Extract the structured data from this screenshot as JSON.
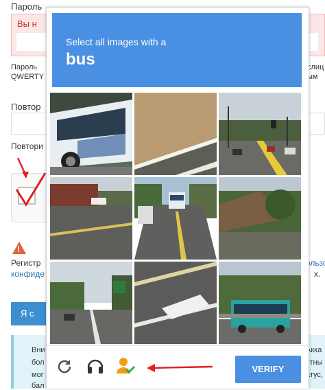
{
  "background_form": {
    "password_label": "Пароль",
    "error_text": "Вы н",
    "password_hint": "Пароль",
    "password_hint_line2": "QWERTY",
    "right_hint_1": "слиц",
    "right_hint_2": "ым",
    "repeat_label_1": "Повтор",
    "repeat_label_2": "Повтори",
    "register_text": "Регистр",
    "register_link_left": "конфиде",
    "register_link_right": "ользо",
    "register_right_2": "х.",
    "submit_button_label": "Я с",
    "info_lines": [
      "Вни",
      "бол",
      "мог",
      "бал"
    ],
    "info_right": [
      "Акка",
      "стны",
      "атус,"
    ],
    "info_bottom": "бал... ... ...ые"
  },
  "challenge": {
    "prompt_text": "Select all images with a",
    "target_word": "bus",
    "tiles": [
      {
        "label": "tile-1"
      },
      {
        "label": "tile-2"
      },
      {
        "label": "tile-3"
      },
      {
        "label": "tile-4"
      },
      {
        "label": "tile-5"
      },
      {
        "label": "tile-6"
      },
      {
        "label": "tile-7"
      },
      {
        "label": "tile-8"
      },
      {
        "label": "tile-9"
      }
    ],
    "footer": {
      "reload_icon": "reload-icon",
      "audio_icon": "headphones-icon",
      "info_icon": "person-check-icon",
      "verify_label": "VERIFY"
    }
  },
  "colors": {
    "header_blue": "#4a90e2",
    "annotation_red": "#e02020",
    "verify_blue": "#4a90e2"
  }
}
